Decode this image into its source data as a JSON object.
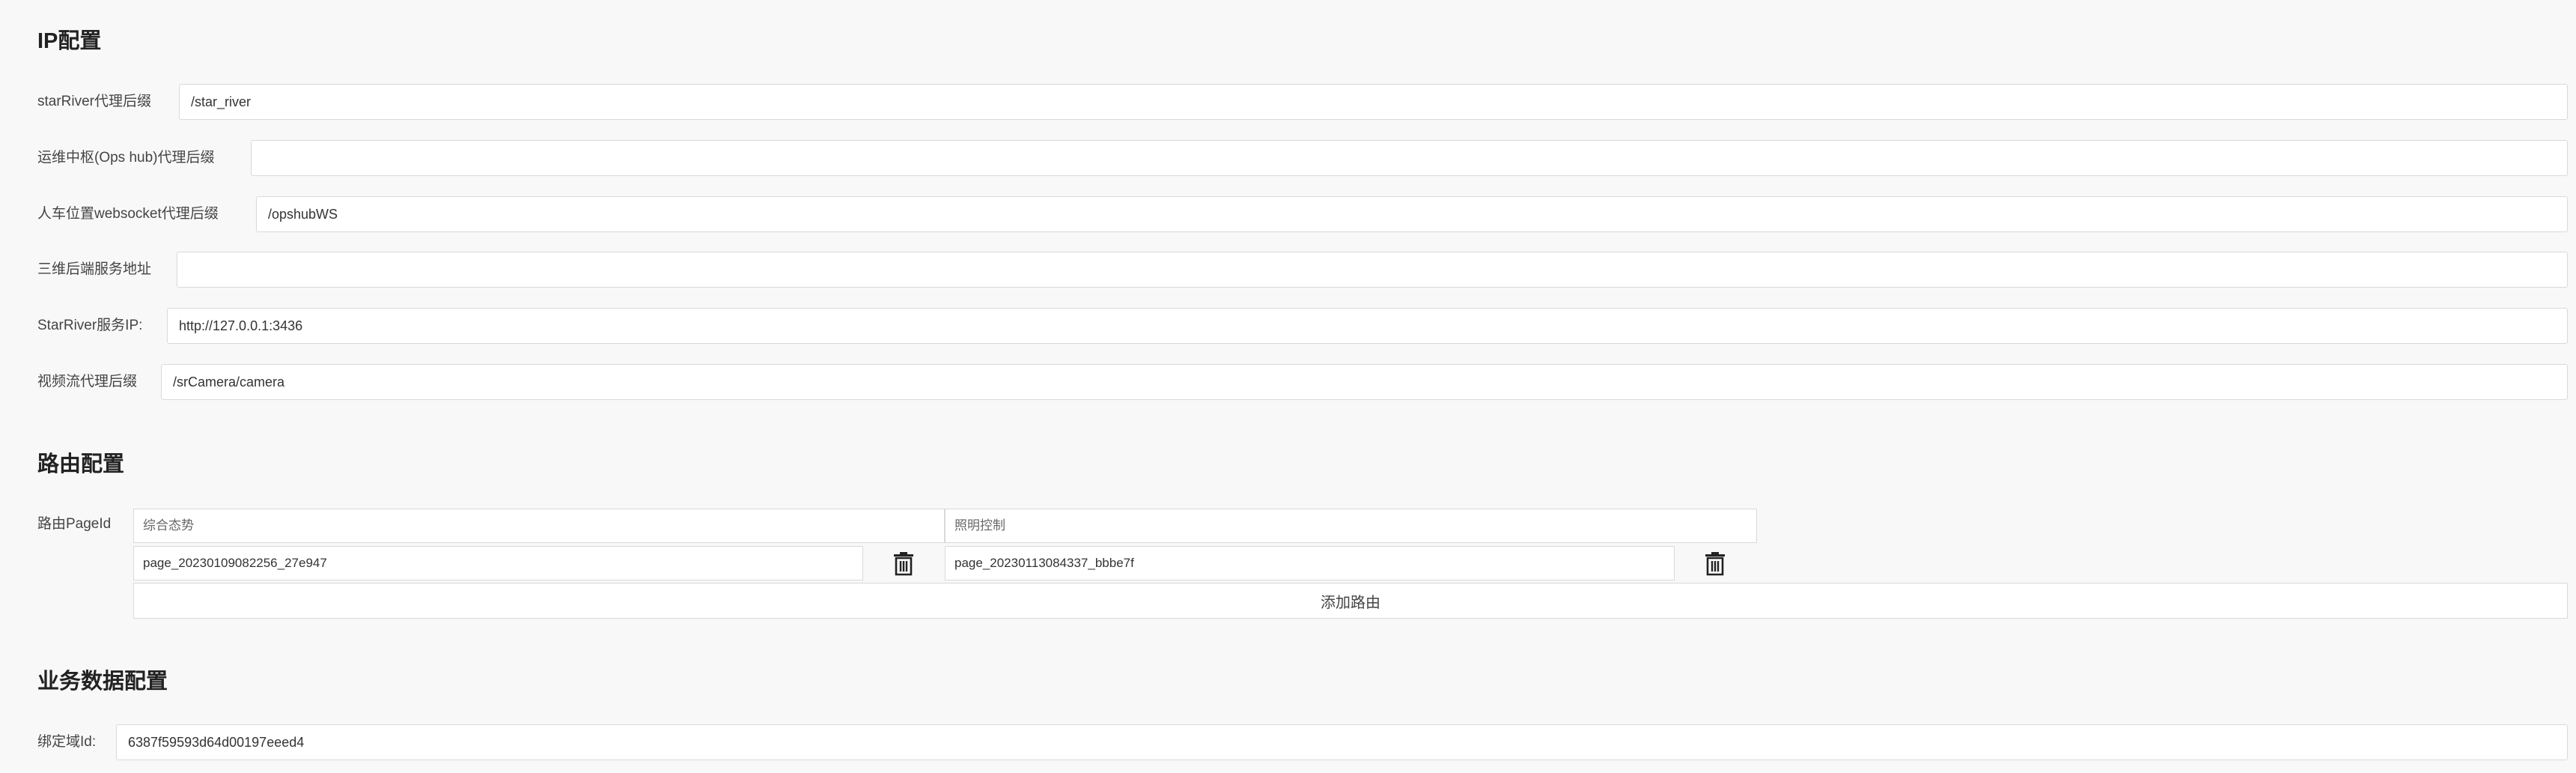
{
  "ip_config": {
    "title": "IP配置",
    "fields": [
      {
        "label": "starRiver代理后缀",
        "value": "/star_river"
      },
      {
        "label": "运维中枢(Ops hub)代理后缀",
        "value": ""
      },
      {
        "label": "人车位置websocket代理后缀",
        "value": "/opshubWS"
      },
      {
        "label": "三维后端服务地址",
        "value": ""
      },
      {
        "label": "StarRiver服务IP:",
        "value": "http://127.0.0.1:3436"
      },
      {
        "label": "视频流代理后缀",
        "value": "/srCamera/camera"
      }
    ]
  },
  "route_config": {
    "title": "路由配置",
    "label": "路由PageId",
    "columns": [
      {
        "name_placeholder": "综合态势",
        "page_id": "page_20230109082256_27e947"
      },
      {
        "name_placeholder": "照明控制",
        "page_id": "page_20230113084337_bbbe7f"
      }
    ],
    "add_button": "添加路由",
    "delete_icon": "trash-icon"
  },
  "business_config": {
    "title": "业务数据配置",
    "fields": [
      {
        "label": "绑定域Id:",
        "value": "6387f59593d64d00197eeed4"
      }
    ]
  },
  "colors": {
    "background": "#f8f8f8",
    "input_border": "#d9d9d9",
    "title_text": "#222222"
  }
}
